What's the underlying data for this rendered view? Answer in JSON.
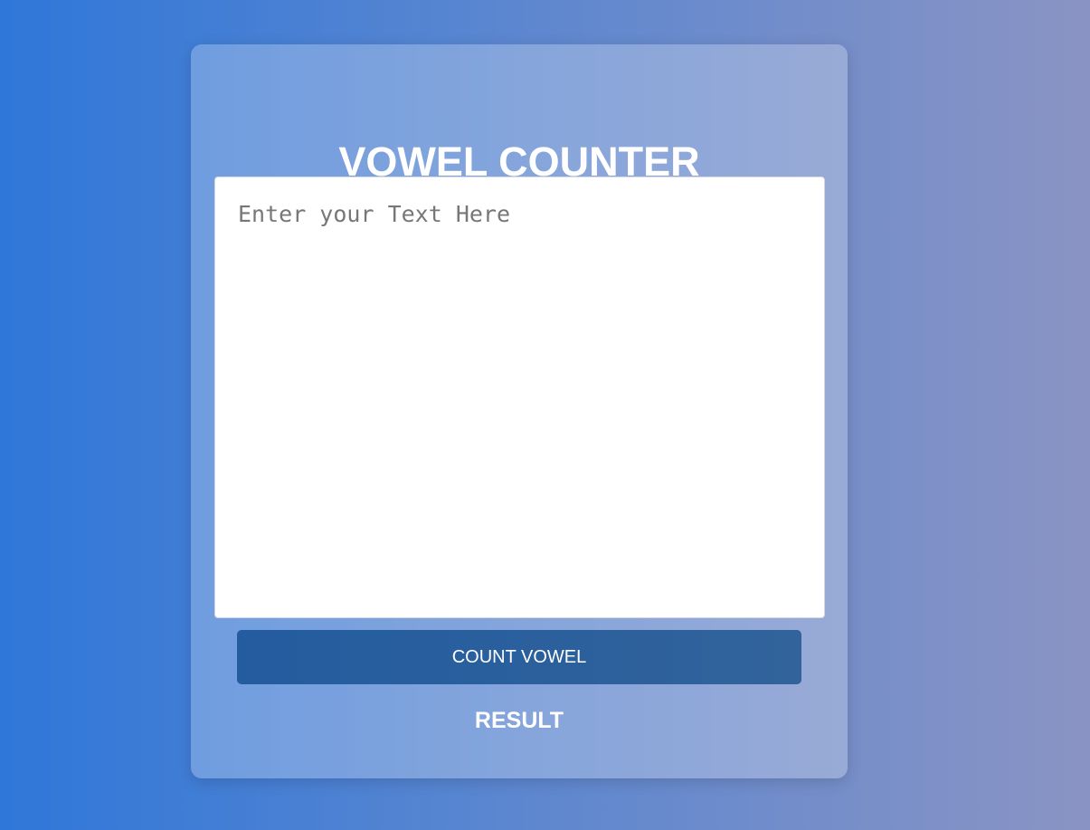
{
  "app": {
    "title": "VOWEL COUNTER"
  },
  "input": {
    "value": "",
    "placeholder": "Enter your Text Here"
  },
  "button": {
    "label": "COUNT VOWEL"
  },
  "result": {
    "label": "RESULT"
  },
  "colors": {
    "bg_start": "#2f77d9",
    "bg_end": "#8a94c4",
    "button": "#235c9f"
  }
}
